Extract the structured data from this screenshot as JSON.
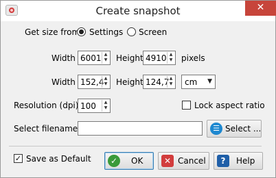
{
  "window": {
    "title": "Create snapshot",
    "close": "✕"
  },
  "size_from": {
    "label": "Get size from",
    "options": [
      {
        "label": "Settings",
        "selected": true
      },
      {
        "label": "Screen",
        "selected": false
      }
    ]
  },
  "pixels_row": {
    "width_label": "Width",
    "width_value": "6001",
    "height_label": "Height",
    "height_value": "4910",
    "unit_label": "pixels"
  },
  "physical_row": {
    "width_label": "Width",
    "width_value": "152,4",
    "height_label": "Height",
    "height_value": "124,7",
    "unit_value": "cm"
  },
  "resolution": {
    "label": "Resolution (dpi)",
    "value": "100"
  },
  "lock_aspect": {
    "label": "Lock aspect ratio",
    "checked": false
  },
  "filename": {
    "label": "Select filename",
    "value": "",
    "button_label": "Select ..."
  },
  "save_default": {
    "label": "Save as Default",
    "checked": true,
    "mark": "✓"
  },
  "buttons": {
    "ok": "OK",
    "cancel": "Cancel",
    "help": "Help"
  },
  "colors": {
    "ok_icon": "#3a9a3a",
    "cancel_icon": "#d23c3c",
    "help_icon": "#1f5fa8",
    "select_icon": "#1e88d0",
    "close_bg": "#c7453b"
  },
  "icons": {
    "app": "camera-lens-icon",
    "ok": "checkmark-icon",
    "cancel": "x-icon",
    "help": "question-icon",
    "select": "list-icon"
  }
}
